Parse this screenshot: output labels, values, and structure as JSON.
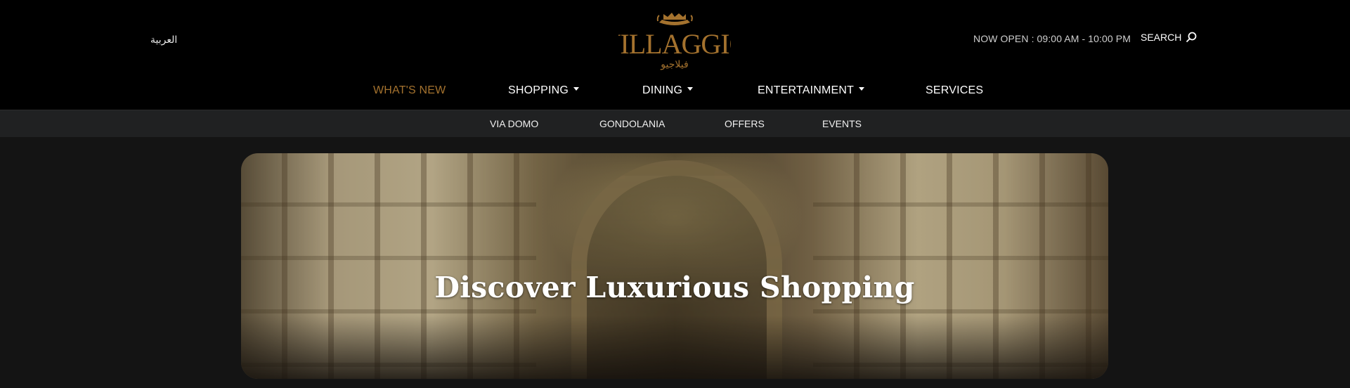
{
  "header": {
    "language_link": "العربية",
    "logo_text": "VILLAGGIO",
    "logo_arabic": "فيلاجيو",
    "hours": "NOW OPEN : 09:00 AM - 10:00 PM",
    "search_label": "SEARCH",
    "search_icon": "search-icon"
  },
  "main_nav": [
    {
      "label": "WHAT'S NEW",
      "active": true,
      "dropdown": false
    },
    {
      "label": "SHOPPING",
      "active": false,
      "dropdown": true
    },
    {
      "label": "DINING",
      "active": false,
      "dropdown": true
    },
    {
      "label": "ENTERTAINMENT",
      "active": false,
      "dropdown": true
    },
    {
      "label": "SERVICES",
      "active": false,
      "dropdown": false
    }
  ],
  "sub_nav": [
    "VIA DOMO",
    "GONDOLANIA",
    "OFFERS",
    "EVENTS"
  ],
  "hero": {
    "title": "Discover Luxurious Shopping"
  },
  "colors": {
    "accent": "#a4722e",
    "header_bg": "#000000",
    "subnav_bg": "#202122",
    "page_bg": "#141414"
  }
}
